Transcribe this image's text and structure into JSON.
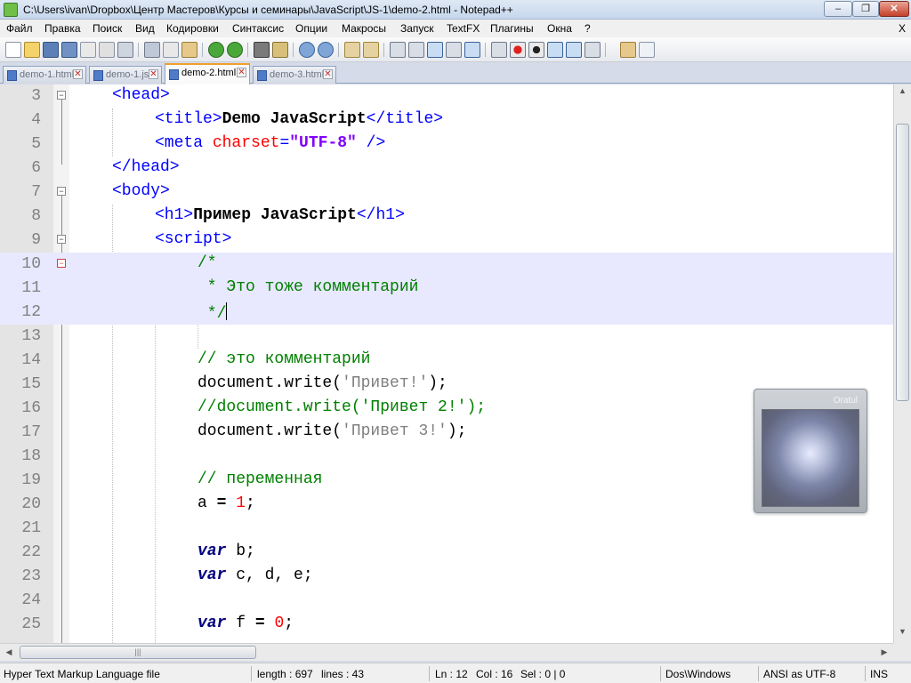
{
  "window": {
    "title": "C:\\Users\\ivan\\Dropbox\\Центр Мастеров\\Курсы и семинары\\JavaScript\\JS-1\\demo-2.html - Notepad++",
    "minimize_label": "–",
    "maximize_label": "❐",
    "close_label": "✕"
  },
  "menu": {
    "items": [
      "Файл",
      "Правка",
      "Поиск",
      "Вид",
      "Кодировки",
      "Синтаксис",
      "Опции",
      "Макросы",
      "Запуск",
      "TextFX",
      "Плагины",
      "Окна",
      "?"
    ],
    "close_label": "X"
  },
  "tabs": [
    {
      "label": "demo-1.html",
      "active": false
    },
    {
      "label": "demo-1.js",
      "active": false
    },
    {
      "label": "demo-2.html",
      "active": true
    },
    {
      "label": "demo-3.html",
      "active": false
    }
  ],
  "editor": {
    "line_numbers": [
      "3",
      "4",
      "5",
      "6",
      "7",
      "8",
      "9",
      "10",
      "11",
      "12",
      "13",
      "14",
      "15",
      "16",
      "17",
      "18",
      "19",
      "20",
      "21",
      "22",
      "23",
      "24",
      "25"
    ],
    "code": {
      "l3_open": "<head>",
      "l4_open": "<title>",
      "l4_text": "Demo JavaScript",
      "l4_close": "</title>",
      "l5_open": "<meta ",
      "l5_attr": "charset",
      "l5_eq": "=",
      "l5_val": "\"UTF-8\"",
      "l5_close": " />",
      "l6_close": "</head>",
      "l7_open": "<body>",
      "l8_open": "<h1>",
      "l8_text": "Пример JavaScript",
      "l8_close": "</h1>",
      "l9_open": "<script>",
      "l10": "/*",
      "l11": " * Это тоже комментарий",
      "l12": " */",
      "l14": "// это комментарий",
      "l15_a": "document.write(",
      "l15_s": "'Привет!'",
      "l15_b": ");",
      "l16": "//document.write('Привет 2!');",
      "l17_a": "document.write(",
      "l17_s": "'Привет 3!'",
      "l17_b": ");",
      "l19": "// переменная",
      "l20_a": "a ",
      "l20_op": "=",
      "l20_sp": " ",
      "l20_n": "1",
      "l20_end": ";",
      "l22_kw": "var",
      "l22_rest": " b;",
      "l23_kw": "var",
      "l23_rest": " c, d, e;",
      "l25_kw": "var",
      "l25_rest": " f ",
      "l25_op": "=",
      "l25_sp": " ",
      "l25_n": "0",
      "l25_end": ";"
    }
  },
  "widget": {
    "label": "Oratul"
  },
  "status": {
    "file_type": "Hyper Text Markup Language file",
    "length": "length : 697",
    "lines": "lines : 43",
    "ln": "Ln : 12",
    "col": "Col : 16",
    "sel": "Sel : 0 | 0",
    "eol": "Dos\\Windows",
    "encoding": "ANSI as UTF-8",
    "mode": "INS"
  },
  "colors": {
    "tag": "#0000ff",
    "attribute": "#ff0000",
    "attr_value": "#8000ff",
    "comment": "#008000",
    "js_string": "#808080",
    "number": "#ff0000",
    "keyword": "#000080",
    "current_line": "#e8e8ff",
    "active_tab_accent": "#f29f2b"
  },
  "toolbar_icons": [
    "new-file-icon",
    "open-file-icon",
    "save-icon",
    "save-all-icon",
    "close-icon",
    "close-all-icon",
    "print-icon",
    "cut-icon",
    "copy-icon",
    "paste-icon",
    "undo-icon",
    "redo-icon",
    "find-icon",
    "replace-icon",
    "zoom-in-icon",
    "zoom-out-icon",
    "sync-v-icon",
    "sync-h-icon",
    "wrap-icon",
    "show-all-chars-icon",
    "indent-guide-icon",
    "fold-icon",
    "unfold-icon",
    "record-macro-icon",
    "stop-macro-icon",
    "play-macro-icon",
    "play-multiple-icon",
    "save-macro-icon",
    "launch-icon",
    "spellcheck-icon"
  ]
}
